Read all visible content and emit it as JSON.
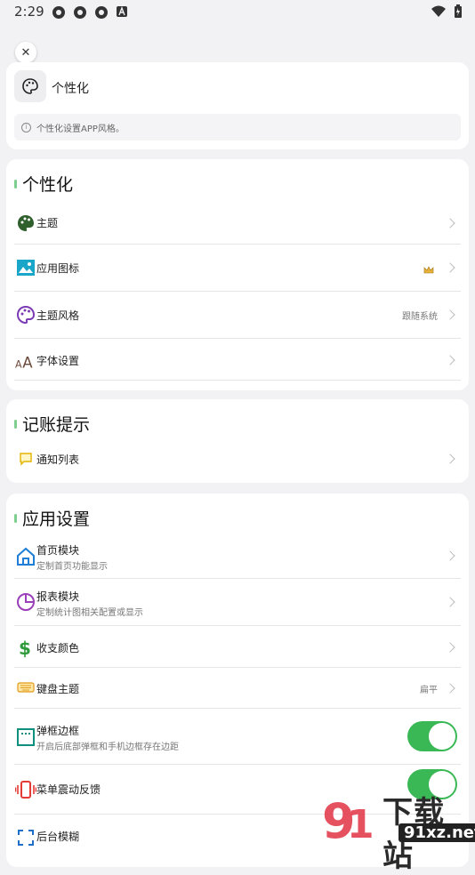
{
  "status": {
    "time": "2:29"
  },
  "header": {
    "title": "个性化",
    "info": "个性化设置APP风格。"
  },
  "sections": [
    {
      "title": "个性化",
      "items": [
        {
          "label": "主题"
        },
        {
          "label": "应用图标",
          "badge": "crown-icon"
        },
        {
          "label": "主题风格",
          "value": "跟随系统"
        },
        {
          "label": "字体设置"
        }
      ]
    },
    {
      "title": "记账提示",
      "items": [
        {
          "label": "通知列表"
        }
      ]
    },
    {
      "title": "应用设置",
      "items": [
        {
          "label": "首页模块",
          "sub": "定制首页功能显示"
        },
        {
          "label": "报表模块",
          "sub": "定制统计图相关配置或显示"
        },
        {
          "label": "收支颜色"
        },
        {
          "label": "键盘主题",
          "value": "扁平"
        },
        {
          "label": "弹框边框",
          "sub": "开启后底部弹框和手机边框存在边距",
          "toggle": true
        },
        {
          "label": "菜单震动反馈",
          "toggle": true
        },
        {
          "label": "后台模糊"
        }
      ]
    }
  ],
  "watermark": {
    "text": "下载站",
    "site": "91xz.net"
  },
  "colors": {
    "toggle_on": "#3ab855",
    "accent_bar": "#7ecf8f"
  }
}
